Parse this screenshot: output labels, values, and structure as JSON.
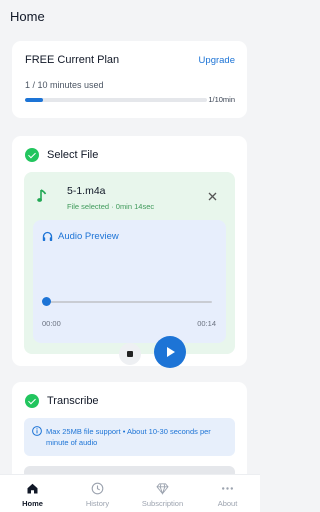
{
  "header": {
    "title": "Home"
  },
  "plan": {
    "name": "FREE Current Plan",
    "upgrade_label": "Upgrade",
    "minutes_used_text": "1 / 10 minutes used",
    "usage_label": "1/10min",
    "usage_fraction": 0.1
  },
  "select_file": {
    "title": "Select File",
    "file_name": "5-1.m4a",
    "file_status": "File selected · 0min 14sec",
    "preview": {
      "title": "Audio Preview",
      "time_start": "00:00",
      "time_end": "00:14",
      "position_fraction": 0.0
    }
  },
  "transcribe": {
    "title": "Transcribe",
    "info_text": "Max 25MB file support • About 10-30 seconds per minute of audio"
  },
  "nav": {
    "items": [
      {
        "label": "Home",
        "icon": "home-icon",
        "active": true
      },
      {
        "label": "History",
        "icon": "clock-icon",
        "active": false
      },
      {
        "label": "Subscription",
        "icon": "diamond-icon",
        "active": false
      },
      {
        "label": "About",
        "icon": "more-icon",
        "active": false
      }
    ]
  },
  "colors": {
    "accent": "#1d74d6",
    "success": "#22c55e",
    "file_box_bg": "#e8f6ec",
    "preview_bg": "#e7eefc"
  }
}
